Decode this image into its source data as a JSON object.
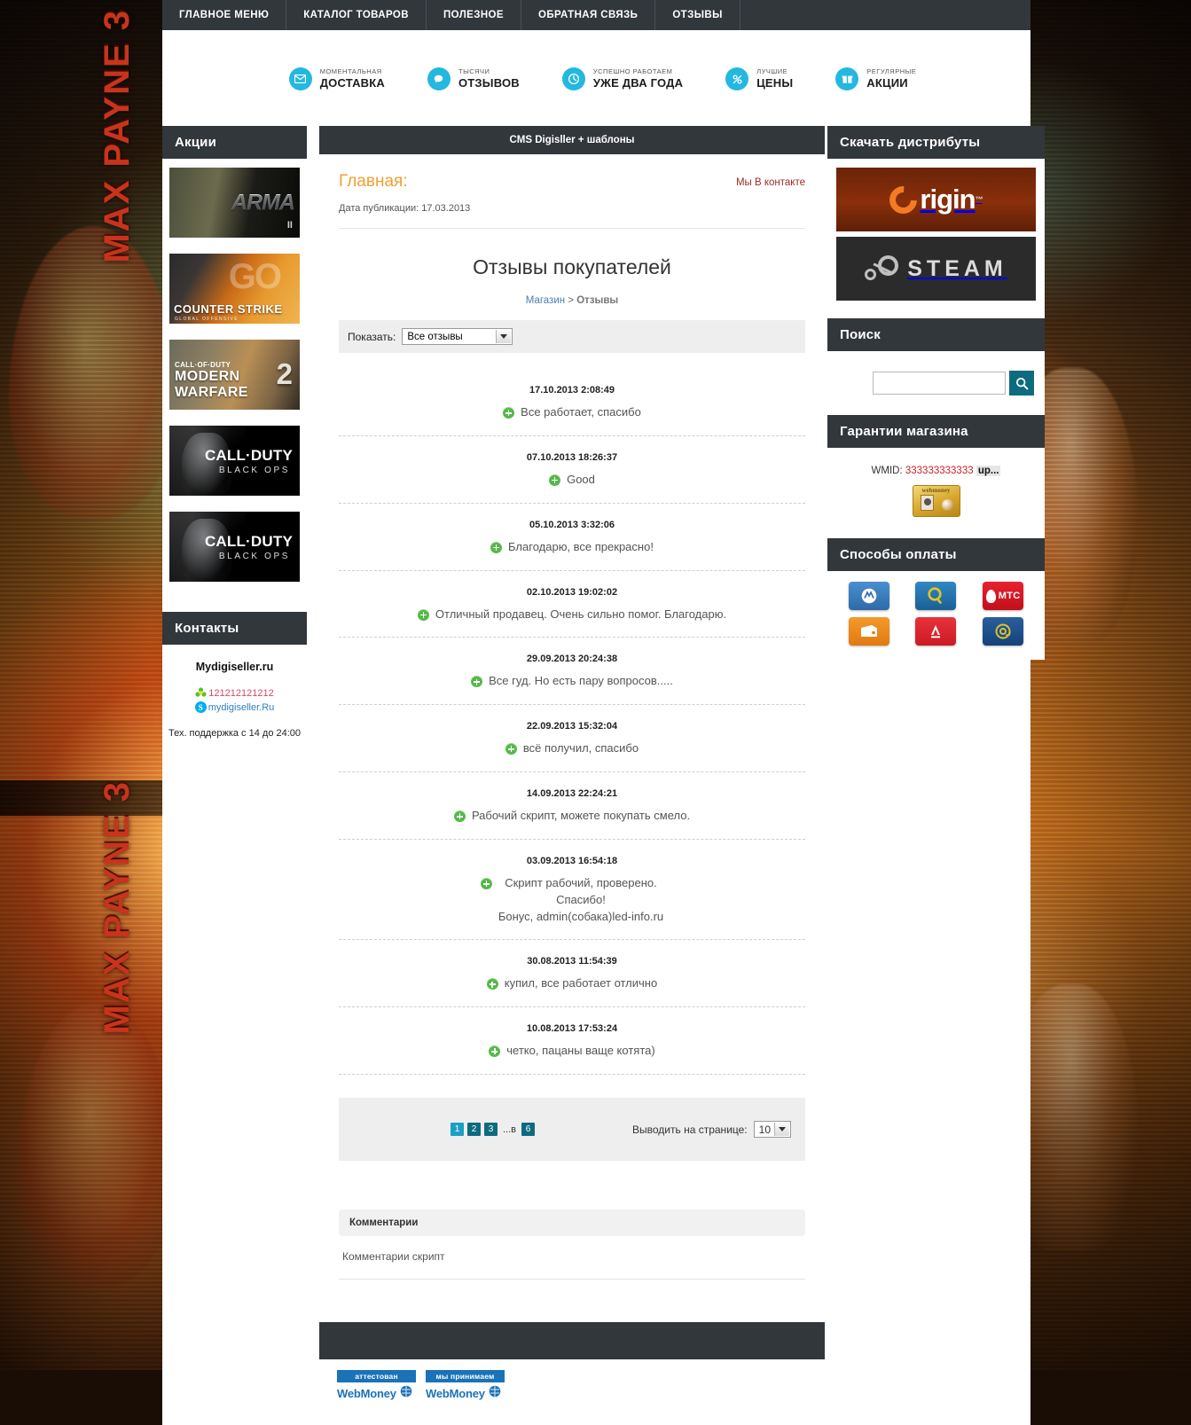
{
  "topnav": {
    "items": [
      {
        "label": "ГЛАВНОЕ МЕНЮ"
      },
      {
        "label": "КАТАЛОГ ТОВАРОВ"
      },
      {
        "label": "ПОЛЕЗНОЕ"
      },
      {
        "label": "ОБРАТНАЯ СВЯЗЬ"
      },
      {
        "label": "ОТЗЫВЫ"
      }
    ]
  },
  "features": [
    {
      "icon": "envelope-icon",
      "small": "МОМЕНТАЛЬНАЯ",
      "big": "ДОСТАВКА"
    },
    {
      "icon": "speech-bubble-icon",
      "small": "ТЫСЯЧИ",
      "big": "ОТЗЫВОВ"
    },
    {
      "icon": "clock-icon",
      "small": "УСПЕШНО РАБОТАЕМ",
      "big": "УЖЕ ДВА ГОДА"
    },
    {
      "icon": "percent-icon",
      "small": "ЛУЧШИЕ",
      "big": "ЦЕНЫ"
    },
    {
      "icon": "gift-icon",
      "small": "РЕГУЛЯРНЫЕ",
      "big": "АКЦИИ"
    }
  ],
  "sidebar_left": {
    "promo_title": "Акции",
    "banners": [
      {
        "name": "arma-2-banner",
        "title": "ARMA",
        "sub": "II"
      },
      {
        "name": "counter-strike-go-banner",
        "title": "COUNTER STRIKE",
        "sub": "GLOBAL OFFENSIVE",
        "badge": "GO"
      },
      {
        "name": "modern-warfare-2-banner",
        "line1": "CALL·OF·DUTY",
        "line2": "MODERN WARFARE",
        "num": "2"
      },
      {
        "name": "black-ops-banner-1",
        "line1": "CALL·DUTY",
        "line2": "BLACK OPS"
      },
      {
        "name": "black-ops-banner-2",
        "line1": "CALL·DUTY",
        "line2": "BLACK OPS"
      }
    ],
    "contacts_title": "Контакты",
    "contacts": {
      "site": "Mydigiseller.ru",
      "icq": "121212121212",
      "skype": "mydigiseller.Ru",
      "support": "Тех. поддержка с 14 до 24:00"
    }
  },
  "main": {
    "strip_title": "CMS Digisller + шаблоны",
    "heading": "Главная:",
    "vk_link": "Мы В контакте",
    "pubdate": "Дата публикации: 17.03.2013",
    "page_title": "Отзывы покупателей",
    "crumb_shop": "Магазин",
    "crumb_sep": ">",
    "crumb_current": "Отзывы",
    "filter_label": "Показать:",
    "filter_value": "Все отзывы",
    "reviews": [
      {
        "date": "17.10.2013 2:08:49",
        "text": "Все работает, спасибо"
      },
      {
        "date": "07.10.2013 18:26:37",
        "text": "Good"
      },
      {
        "date": "05.10.2013 3:32:06",
        "text": "Благодарю, все прекрасно!"
      },
      {
        "date": "02.10.2013 19:02:02",
        "text": "Отличный продавец. Очень сильно помог. Благодарю."
      },
      {
        "date": "29.09.2013 20:24:38",
        "text": "Все гуд. Но есть пару вопросов....."
      },
      {
        "date": "22.09.2013 15:32:04",
        "text": "всё получил, спасибо"
      },
      {
        "date": "14.09.2013 22:24:21",
        "text": "Рабочий скрипт, можете покупать смело."
      },
      {
        "date": "03.09.2013 16:54:18",
        "text": "Скрипт рабочий, проверено.\nСпасибо!\nБонус, admin(собака)led-info.ru"
      },
      {
        "date": "30.08.2013 11:54:39",
        "text": "купил, все работает отлично"
      },
      {
        "date": "10.08.2013 17:53:24",
        "text": "четко, пацаны ваще котята)"
      }
    ],
    "pagination": {
      "pages": [
        "1",
        "2",
        "3"
      ],
      "active": "1",
      "separator": "...в",
      "last": "6"
    },
    "perpage_label": "Выводить на странице:",
    "perpage_value": "10",
    "comments_title": "Комментарии",
    "comments_body": "Комментарии скрипт"
  },
  "sidebar_right": {
    "distrib_title": "Скачать дистрибуты",
    "origin_label": "rigin",
    "origin_tm": "™",
    "steam_label": "STEAM",
    "search_title": "Поиск",
    "search_value": "",
    "guarantee_title": "Гарантии магазина",
    "wmid_label": "WMID:",
    "wmid_value": "333333333333",
    "wmid_badge": "up...",
    "webmoney_cert_label": "webmoney",
    "payments_title": "Способы оплаты",
    "payments": [
      {
        "name": "webmoney-pay-icon",
        "label": ""
      },
      {
        "name": "qiwi-pay-icon",
        "label": "Q"
      },
      {
        "name": "mts-pay-icon",
        "label": "МТС"
      },
      {
        "name": "yandex-money-pay-icon",
        "label": ""
      },
      {
        "name": "alfa-bank-pay-icon",
        "label": "A"
      },
      {
        "name": "mail-money-pay-icon",
        "label": "@"
      }
    ]
  },
  "footer": {
    "badges": [
      {
        "top": "аттестован",
        "name": "WebMoney"
      },
      {
        "top": "мы принимаем",
        "name": "WebMoney"
      }
    ]
  },
  "background": {
    "game_title": "MAX PAYNE 3"
  },
  "colors": {
    "nav_dark": "#32373c",
    "accent_cyan": "#23b8e0",
    "heading_orange": "#f0a030",
    "teal": "#0d6b80",
    "page_active": "#1b9fc4",
    "plus_green": "#54b948",
    "vk_red": "#9e2b2b"
  }
}
